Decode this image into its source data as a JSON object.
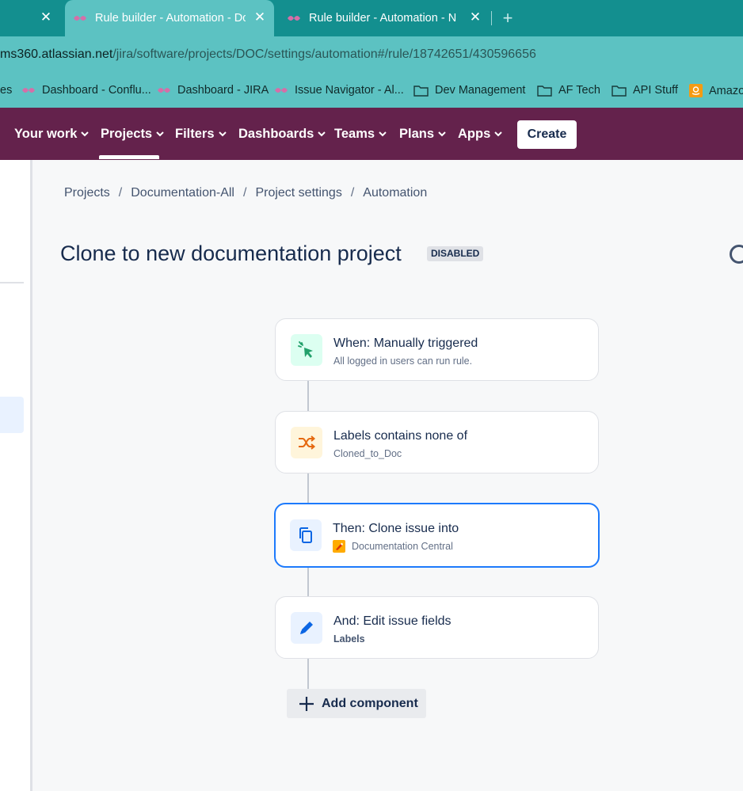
{
  "browser": {
    "tabs": [
      {
        "title": "",
        "active": false
      },
      {
        "title": "Rule builder - Automation - Documentation-All",
        "active": true
      },
      {
        "title": "Rule builder - Automation - Nikita",
        "active": false
      }
    ],
    "new_tab_symbol": "+",
    "close_symbol": "✕",
    "url_host": "ms360.atlassian.net",
    "url_path": "/jira/software/projects/DOC/settings/automation#/rule/18742651/430596656",
    "bookmarks": [
      {
        "label": "es",
        "icon": "none"
      },
      {
        "label": "Dashboard - Conflu...",
        "icon": "atlassian-icon"
      },
      {
        "label": "Dashboard - JIRA",
        "icon": "atlassian-icon"
      },
      {
        "label": "Issue Navigator - Al...",
        "icon": "atlassian-icon"
      },
      {
        "label": "Dev Management",
        "icon": "folder-icon"
      },
      {
        "label": "AF Tech",
        "icon": "folder-icon"
      },
      {
        "label": "API Stuff",
        "icon": "folder-icon"
      },
      {
        "label": "Amazon",
        "icon": "amazon-icon"
      }
    ]
  },
  "nav": {
    "items": [
      {
        "label": "Your work"
      },
      {
        "label": "Projects"
      },
      {
        "label": "Filters"
      },
      {
        "label": "Dashboards"
      },
      {
        "label": "Teams"
      },
      {
        "label": "Plans"
      },
      {
        "label": "Apps"
      }
    ],
    "create_label": "Create",
    "active_item": "Projects",
    "bg_color": "#64224c"
  },
  "breadcrumb": {
    "items": [
      "Projects",
      "Documentation-All",
      "Project settings",
      "Automation"
    ],
    "separator": "/"
  },
  "rule": {
    "title": "Clone to new documentation project",
    "status": "DISABLED",
    "components": [
      {
        "title": "When: Manually triggered",
        "subtitle": "All logged in users can run rule.",
        "icon": "cursor-click-icon",
        "color": "#22a06b"
      },
      {
        "title": "Labels contains none of",
        "subtitle": "Cloned_to_Doc",
        "icon": "shuffle-icon",
        "color": "#e56910"
      },
      {
        "title": "Then: Clone issue into",
        "subtitle": "Documentation Central",
        "icon": "copy-icon",
        "color": "#0c66e4",
        "selected": true
      },
      {
        "title": "And: Edit issue fields",
        "subtitle": "Labels",
        "icon": "pencil-icon",
        "color": "#0c66e4"
      }
    ],
    "add_component_label": "Add component"
  }
}
